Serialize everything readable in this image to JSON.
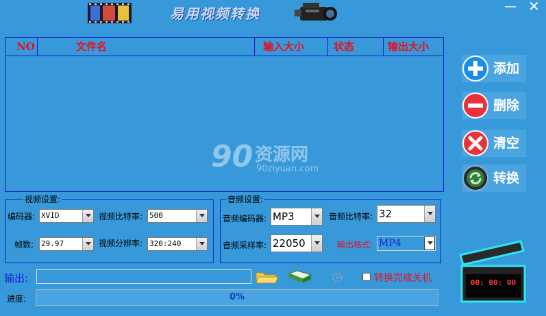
{
  "app": {
    "title": "易用视频转换"
  },
  "window": {
    "minimize_symbol": "—",
    "close_symbol": "✕"
  },
  "file_table": {
    "columns": [
      "NO",
      "文件名",
      "输入大小",
      "状态",
      "输出大小"
    ],
    "rows": []
  },
  "watermark": {
    "brand": "资源网",
    "url": "90ziyuan.com",
    "number": "90"
  },
  "side_buttons": [
    {
      "label": "添加",
      "icon": "plus-circle-icon",
      "color": "#1a8ee6"
    },
    {
      "label": "删除",
      "icon": "minus-circle-icon",
      "color": "#e8323a"
    },
    {
      "label": "清空",
      "icon": "x-circle-icon",
      "color": "#e8323a"
    },
    {
      "label": "转换",
      "icon": "refresh-circle-icon",
      "color": "#2f7d3a"
    }
  ],
  "video_settings": {
    "title": "视频设置:",
    "encoder_label": "编码器:",
    "encoder_value": "XVID",
    "bitrate_label": "视频比特率:",
    "bitrate_value": "500",
    "fps_label": "帧数:",
    "fps_value": "29.97",
    "resolution_label": "视频分辨率:",
    "resolution_value": "320:240"
  },
  "audio_settings": {
    "title": "音频设置:",
    "encoder_label": "音频编码器:",
    "encoder_value": "MP3",
    "bitrate_label": "音频比特率:",
    "bitrate_value": "32",
    "samplerate_label": "音频采样率:",
    "samplerate_value": "22050",
    "format_label": "输出格式:",
    "format_value": "MP4"
  },
  "output": {
    "label": "输出:",
    "path_value": "",
    "shutdown_label": "转换完成关机",
    "shutdown_checked": false
  },
  "progress": {
    "label": "进度:",
    "text": "0%",
    "value": 0
  },
  "timer": {
    "text": "00: 00: 00"
  },
  "colors": {
    "background": "#3799da",
    "header_text": "#e8101f",
    "border": "#0c21c9"
  }
}
